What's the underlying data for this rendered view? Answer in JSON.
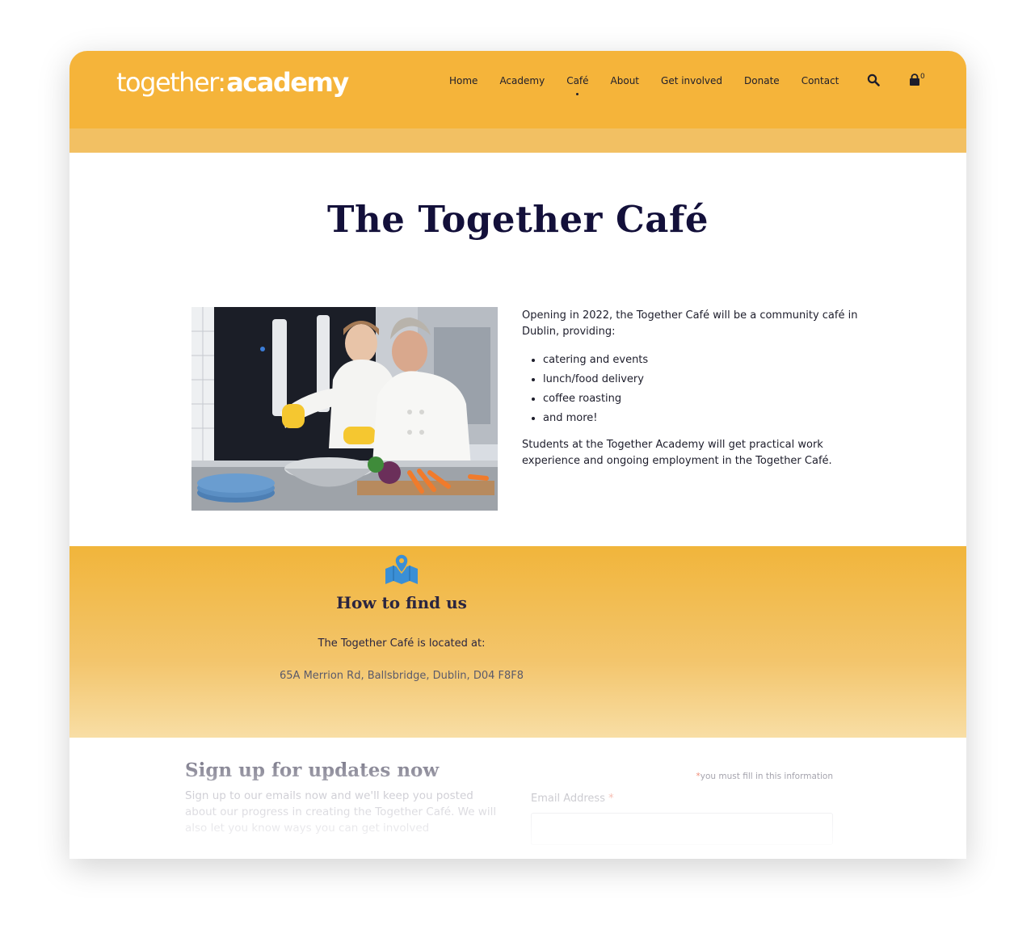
{
  "header": {
    "logo_light": "together",
    "logo_bold": "academy",
    "logo_dot": ":",
    "nav": [
      {
        "label": "Home"
      },
      {
        "label": "Academy"
      },
      {
        "label": "Café",
        "active": true
      },
      {
        "label": "About"
      },
      {
        "label": "Get involved"
      },
      {
        "label": "Donate"
      },
      {
        "label": "Contact"
      }
    ],
    "search_icon": "search-icon",
    "cart_icon": "shopping-bag-icon",
    "cart_count": "0"
  },
  "colors": {
    "header_bg": "#f5b43a",
    "subbar_bg": "#f2c063",
    "title": "#13103a",
    "map_icon": "#3a8fd6"
  },
  "main": {
    "title": "The Together Café",
    "intro_text": "Opening in 2022, the Together Café will be a community café in Dublin, providing:",
    "bullets": [
      "catering and events",
      "lunch/food delivery",
      "coffee roasting",
      "and more!"
    ],
    "students_text": "Students at the Together Academy will get practical work experience and ongoing employment in the Together Café."
  },
  "find_us": {
    "icon": "map-pin-icon",
    "title": "How to find us",
    "located_text": "The Together Café is located at:",
    "address": "65A Merrion Rd, Ballsbridge, Dublin, D04 F8F8"
  },
  "signup": {
    "title": "Sign up for updates now",
    "body": "Sign up to our emails now and we'll keep you posted about our progress in creating the Together Café. We will also let you know ways you can get involved",
    "required_note": "you must fill in this information",
    "required_star": "*",
    "email_label": "Email Address",
    "email_value": ""
  }
}
